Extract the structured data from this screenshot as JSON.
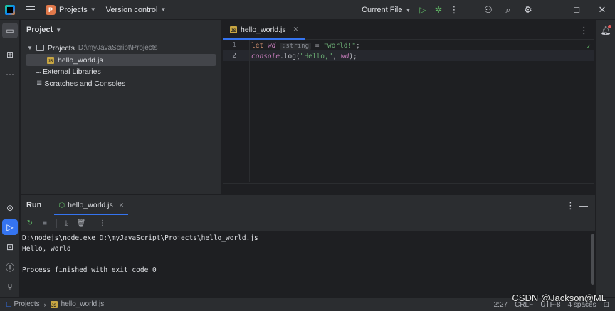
{
  "titlebar": {
    "project_badge": "P",
    "project_label": "Projects",
    "vcs_label": "Version control",
    "run_config": "Current File"
  },
  "project_panel": {
    "title": "Project",
    "tree": [
      {
        "label": "Projects",
        "path": "D:\\myJavaScript\\Projects"
      },
      {
        "label": "hello_world.js"
      },
      {
        "label": "External Libraries"
      },
      {
        "label": "Scratches and Consoles"
      }
    ]
  },
  "editor": {
    "tab_label": "hello_world.js",
    "line_numbers": [
      "1",
      "2"
    ],
    "line1": {
      "kw": "let",
      "var": "wd",
      "hint": ":string",
      "op": " = ",
      "str": "\"world!\"",
      "end": ";"
    },
    "line2": {
      "obj": "console",
      "dot": ".log(",
      "str": "\"Hello,\"",
      "sep": ", ",
      "var": "wd",
      "end": ");"
    }
  },
  "run": {
    "title": "Run",
    "tab_label": "hello_world.js",
    "console": [
      "D:\\nodejs\\node.exe D:\\myJavaScript\\Projects\\hello_world.js",
      "Hello, world!",
      "",
      "Process finished with exit code 0"
    ]
  },
  "statusbar": {
    "crumb_root": "Projects",
    "crumb_file": "hello_world.js",
    "position": "2:27",
    "line_sep": "CRLF",
    "encoding": "UTF-8",
    "indent": "4 spaces"
  },
  "watermark": "CSDN @Jackson@ML",
  "colors": {
    "accent": "#3574f0",
    "keyword": "#cf8e6d",
    "string": "#6aab73",
    "variable": "#c77dbb",
    "js_icon": "#c8a642"
  }
}
